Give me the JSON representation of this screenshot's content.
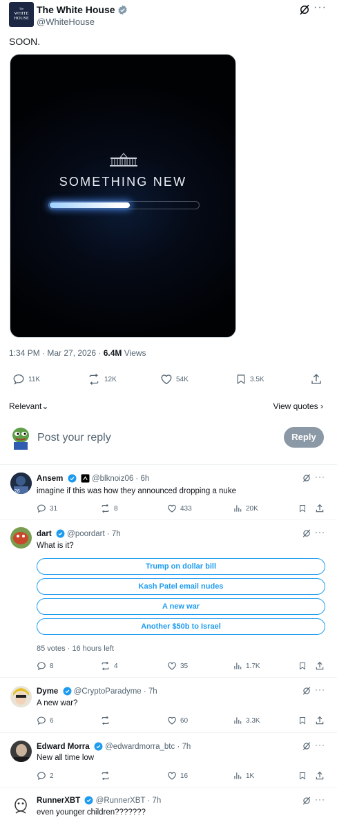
{
  "main": {
    "avatar_text_1": "The",
    "avatar_text_2": "WHITE",
    "avatar_text_3": "HOUSE",
    "author_name": "The White House",
    "author_handle": "@WhiteHouse",
    "text": "SOON.",
    "media_title": "SOMETHING NEW",
    "media_progress": 0.54,
    "time": "1:34 PM · Mar 27, 2026 · ",
    "views_count": "6.4M",
    "views_label": " Views",
    "stats": {
      "replies": "11K",
      "reposts": "12K",
      "likes": "54K",
      "bookmarks": "3.5K"
    }
  },
  "sort": {
    "relevant": "Relevant",
    "view_quotes": "View quotes"
  },
  "composer": {
    "placeholder": "Post your reply",
    "button": "Reply"
  },
  "replies": [
    {
      "name": "Ansem",
      "handle": "@blknoiz06 · 6h",
      "text": "imagine if this was how they announced dropping a nuke",
      "replies": "31",
      "reposts": "8",
      "likes": "433",
      "views": "20K"
    },
    {
      "name": "dart",
      "handle": "@poordart · 7h",
      "text": "What is it?",
      "poll_options": [
        "Trump on dollar bill",
        "Kash Patel email nudes",
        "A new war",
        "Another $50b to Israel"
      ],
      "poll_meta": "85 votes · 16 hours left",
      "replies": "8",
      "reposts": "4",
      "likes": "35",
      "views": "1.7K"
    },
    {
      "name": "Dyme",
      "handle": "@CryptoParadyme · 7h",
      "text": "A new war?",
      "replies": "6",
      "reposts": "",
      "likes": "60",
      "views": "3.3K"
    },
    {
      "name": "Edward Morra",
      "handle": "@edwardmorra_btc · 7h",
      "text": "New all time low",
      "replies": "2",
      "reposts": "",
      "likes": "16",
      "views": "1K"
    },
    {
      "name": "RunnerXBT",
      "handle": "@RunnerXBT · 7h",
      "text": "even younger children???????"
    }
  ],
  "colors": {
    "accent": "#1d9bf0",
    "verified": "#1d9bf0",
    "muted": "#536471",
    "reply_button": "#8b98a5"
  }
}
